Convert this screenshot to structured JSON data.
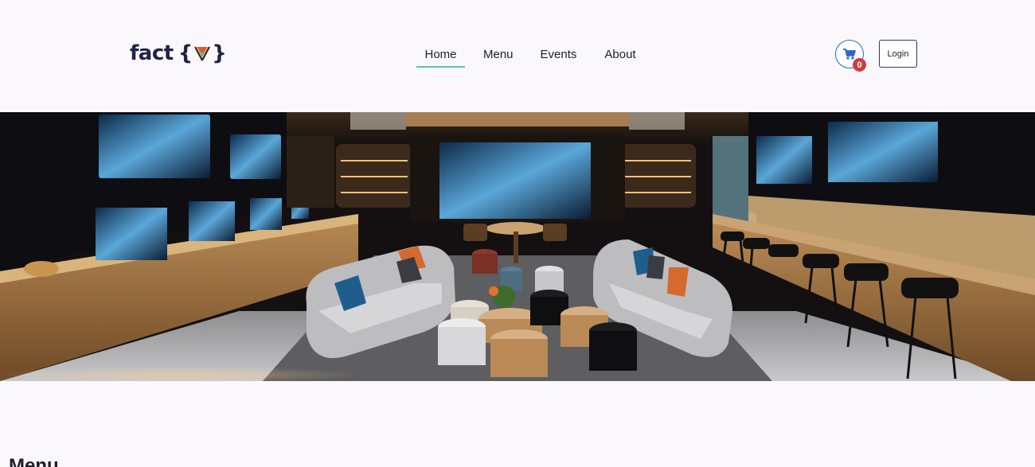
{
  "brand": {
    "name": "fact"
  },
  "nav": {
    "home": "Home",
    "menu": "Menu",
    "events": "Events",
    "about": "About"
  },
  "cart": {
    "count": "0",
    "icon": "shopping-cart-icon"
  },
  "login": {
    "label": "Login"
  },
  "hero": {
    "icon": "lounge-interior-image"
  },
  "section": {
    "title": "Menu"
  },
  "colors": {
    "accent": "#5cc2b3",
    "cart_border": "#2a67c7",
    "badge": "#d23b3b",
    "brand": "#1f2347"
  }
}
